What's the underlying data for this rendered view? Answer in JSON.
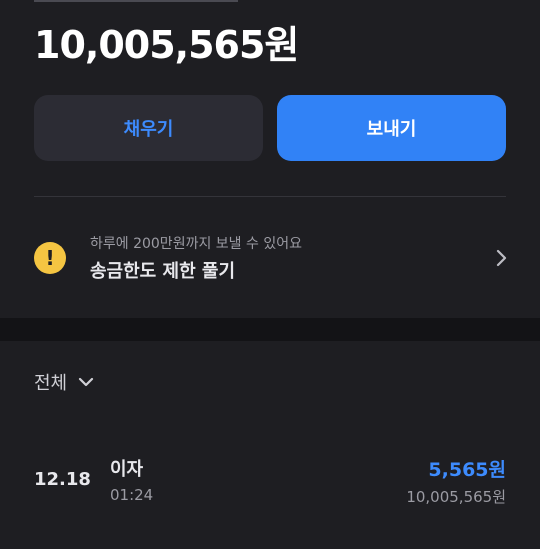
{
  "account": {
    "balance": "10,005,565원"
  },
  "actions": {
    "fill_label": "채우기",
    "send_label": "보내기"
  },
  "limit_notice": {
    "subtitle": "하루에 200만원까지 보낼 수 있어요",
    "title": "송금한도 제한 풀기",
    "icon": "warning-icon"
  },
  "filter": {
    "label": "전체"
  },
  "transactions": [
    {
      "date": "12.18",
      "title": "이자",
      "time": "01:24",
      "amount": "5,565원",
      "balance_after": "10,005,565원"
    }
  ],
  "colors": {
    "accent": "#3182f6",
    "accent_text": "#3d8bfd",
    "warning": "#f5c542",
    "background": "#1e1e22"
  }
}
